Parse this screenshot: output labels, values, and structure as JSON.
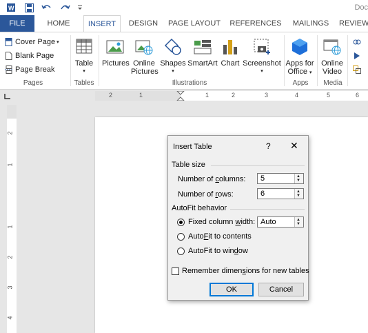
{
  "app": {
    "doc_title": "Doc"
  },
  "quick_access": {
    "icons": [
      "word-app-icon",
      "save-icon",
      "undo-icon",
      "redo-icon",
      "customize-qat-icon"
    ]
  },
  "tabs": [
    {
      "label": "FILE"
    },
    {
      "label": "HOME"
    },
    {
      "label": "INSERT"
    },
    {
      "label": "DESIGN"
    },
    {
      "label": "PAGE LAYOUT"
    },
    {
      "label": "REFERENCES"
    },
    {
      "label": "MAILINGS"
    },
    {
      "label": "REVIEW"
    }
  ],
  "ribbon": {
    "pages": {
      "group": "Pages",
      "items": [
        "Cover Page",
        "Blank Page",
        "Page Break"
      ]
    },
    "tables": {
      "group": "Tables",
      "table": "Table"
    },
    "illustrations": {
      "group": "Illustrations",
      "pictures": "Pictures",
      "online_pictures_1": "Online",
      "online_pictures_2": "Pictures",
      "shapes": "Shapes",
      "smartart": "SmartArt",
      "chart": "Chart",
      "screenshot": "Screenshot"
    },
    "apps": {
      "group": "Apps",
      "apps_for_1": "Apps for",
      "apps_for_2": "Office"
    },
    "media": {
      "group": "Media",
      "online_video_1": "Online",
      "online_video_2": "Video"
    }
  },
  "ruler": {
    "h_numbers": [
      "2",
      "1",
      "1",
      "2",
      "3",
      "4",
      "5",
      "6"
    ],
    "v_numbers": [
      "2",
      "1",
      "1",
      "2",
      "3",
      "4"
    ]
  },
  "dialog": {
    "title": "Insert Table",
    "help": "?",
    "close": "✕",
    "table_size": "Table size",
    "columns_label_a": "Number of ",
    "columns_label_u": "c",
    "columns_label_b": "olumns:",
    "columns_value": "5",
    "rows_label_a": "Number of ",
    "rows_label_u": "r",
    "rows_label_b": "ows:",
    "rows_value": "6",
    "autofit_behavior": "AutoFit behavior",
    "fixed_a": "Fixed column ",
    "fixed_u": "w",
    "fixed_b": "idth:",
    "fixed_value": "Auto",
    "fit_contents_a": "Auto",
    "fit_contents_u": "F",
    "fit_contents_b": "it to contents",
    "fit_window_a": "AutoFit to win",
    "fit_window_u": "d",
    "fit_window_b": "ow",
    "remember_a": "Remember dimen",
    "remember_u": "s",
    "remember_b": "ions for new tables",
    "ok": "OK",
    "cancel": "Cancel"
  }
}
